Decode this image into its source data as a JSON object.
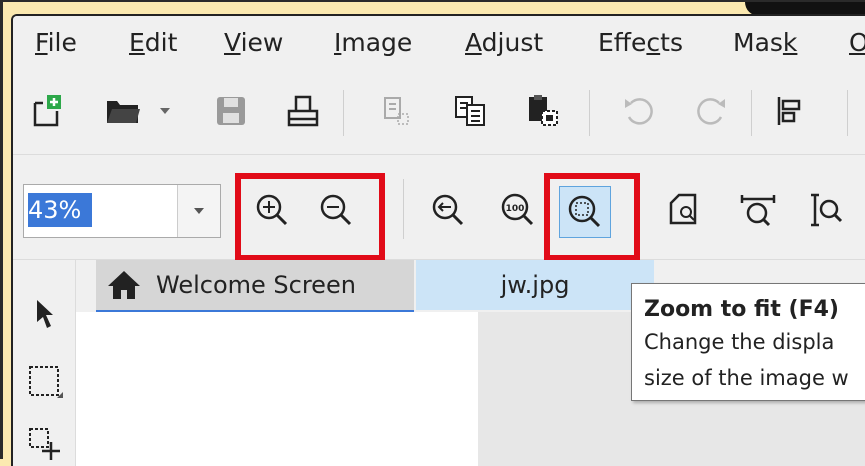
{
  "menu": {
    "items": [
      {
        "pre": "",
        "u": "F",
        "post": "ile"
      },
      {
        "pre": "",
        "u": "E",
        "post": "dit"
      },
      {
        "pre": "",
        "u": "V",
        "post": "iew"
      },
      {
        "pre": "",
        "u": "I",
        "post": "mage"
      },
      {
        "pre": "",
        "u": "A",
        "post": "djust"
      },
      {
        "pre": "Effe",
        "u": "c",
        "post": "ts"
      },
      {
        "pre": "Mas",
        "u": "k",
        "post": ""
      },
      {
        "pre": "",
        "u": "O",
        "post": ""
      }
    ]
  },
  "zoom": {
    "value": "43%"
  },
  "tabs": {
    "welcome": "Welcome Screen",
    "file": "jw.jpg"
  },
  "tooltip": {
    "title": "Zoom to fit (F4)",
    "line1": "Change the displa",
    "line2": "size of the image w"
  },
  "colors": {
    "highlight_border": "#e10b18",
    "accent": "#3b78d8",
    "active_tab": "#cce4f7"
  }
}
